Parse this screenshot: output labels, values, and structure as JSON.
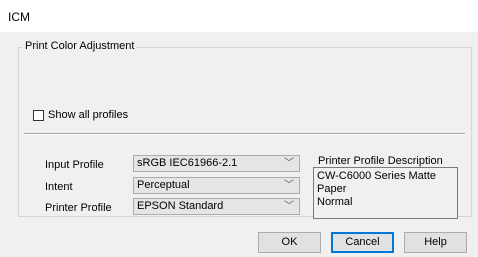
{
  "window": {
    "title": "ICM"
  },
  "group": {
    "label": "Print Color Adjustment",
    "show_all_profiles": {
      "label": "Show all profiles",
      "checked": false
    }
  },
  "fields": {
    "input_profile": {
      "label": "Input Profile",
      "value": "sRGB IEC61966-2.1"
    },
    "intent": {
      "label": "Intent",
      "value": "Perceptual"
    },
    "printer_profile": {
      "label": "Printer Profile",
      "value": "EPSON Standard"
    }
  },
  "description": {
    "label": "Printer Profile Description",
    "text": "CW-C6000 Series Matte Paper\nNormal"
  },
  "buttons": {
    "ok": "OK",
    "cancel": "Cancel",
    "help": "Help"
  }
}
